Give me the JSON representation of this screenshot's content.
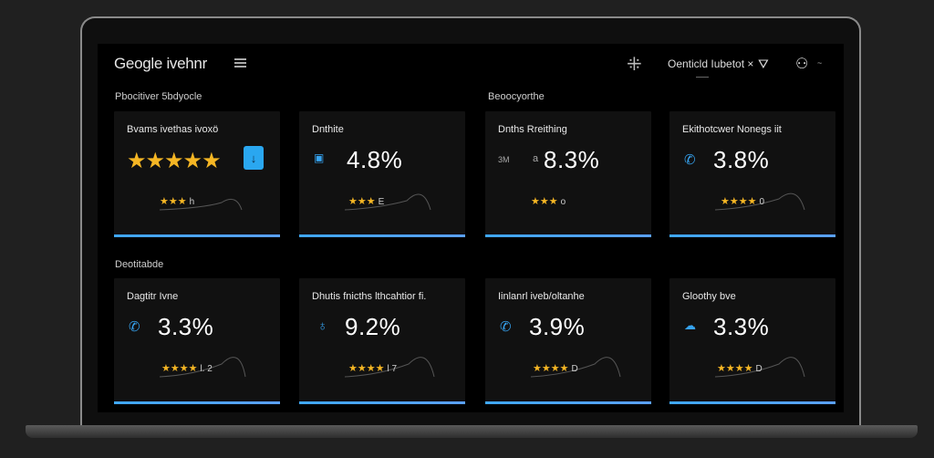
{
  "header": {
    "logo": "Geogle ivehnr",
    "account_label": "Oenticld Iubetot ×",
    "icons": {
      "menu": "hamburger-icon",
      "tool": "crosshair-icon",
      "bag": "bag-icon",
      "user": "user-icon",
      "caret": "chevron-down-icon"
    },
    "user_caret": "~"
  },
  "sections": {
    "top_left": "Pbocitiver 5bdyocle",
    "top_right": "Beoocyorthe",
    "bottom_left": "Deotitabde"
  },
  "accent_color": "#3fa7f5",
  "star_color": "#f5b624",
  "cards": [
    {
      "title": "Bvams ivethas ivoxö",
      "stars_suffix": "h"
    },
    {
      "title": "Dnthite",
      "value": "4.8%",
      "stars_suffix": "E"
    },
    {
      "title": "Dnths Rreithing",
      "small_left": "3M",
      "small_mid": "a",
      "value": "8.3%",
      "stars_suffix": "o"
    },
    {
      "title": "Ekithotcwer Nonegs iit",
      "value": "3.8%",
      "stars_suffix": "0"
    },
    {
      "title": "Dagtitr Ivne",
      "value": "3.3%",
      "stars_suffix": "l. 2"
    },
    {
      "title": "Dhutis fnicths lthcahtior fi.",
      "value": "9.2%",
      "stars_suffix": "l 7"
    },
    {
      "title": "Iinlanrl iveb/oltanhe",
      "value": "3.9%",
      "stars_suffix": "D"
    },
    {
      "title": "Gloothy bve",
      "value": "3.3%",
      "stars_suffix": "D"
    }
  ],
  "big_rating_stars": "★★★★★",
  "small_stars": "★★★",
  "small_stars_4": "★★★★",
  "badge_glyph": "↓"
}
